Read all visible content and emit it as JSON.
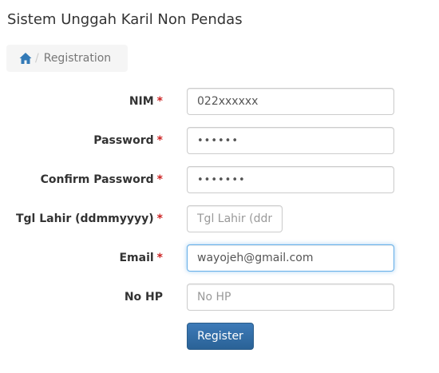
{
  "page": {
    "title": "Sistem Unggah Karil Non Pendas"
  },
  "breadcrumb": {
    "home_icon": "home-icon",
    "separator": "/",
    "current": "Registration"
  },
  "form": {
    "required_marker": "*",
    "nim": {
      "label": "NIM",
      "value": "022xxxxxx"
    },
    "password": {
      "label": "Password",
      "value": "aaaaaa"
    },
    "confirm_password": {
      "label": "Confirm Password",
      "value": "aaaaaaa"
    },
    "tgl_lahir": {
      "label": "Tgl Lahir (ddmmyyyy)",
      "value": "",
      "placeholder": "Tgl Lahir (ddmmyyyy)"
    },
    "email": {
      "label": "Email",
      "value": "wayojeh@gmail.com"
    },
    "no_hp": {
      "label": "No HP",
      "value": "",
      "placeholder": "No HP"
    },
    "submit_label": "Register"
  },
  "colors": {
    "primary": "#337ab7",
    "required": "#cc2222",
    "focus_border": "#66afe9"
  }
}
